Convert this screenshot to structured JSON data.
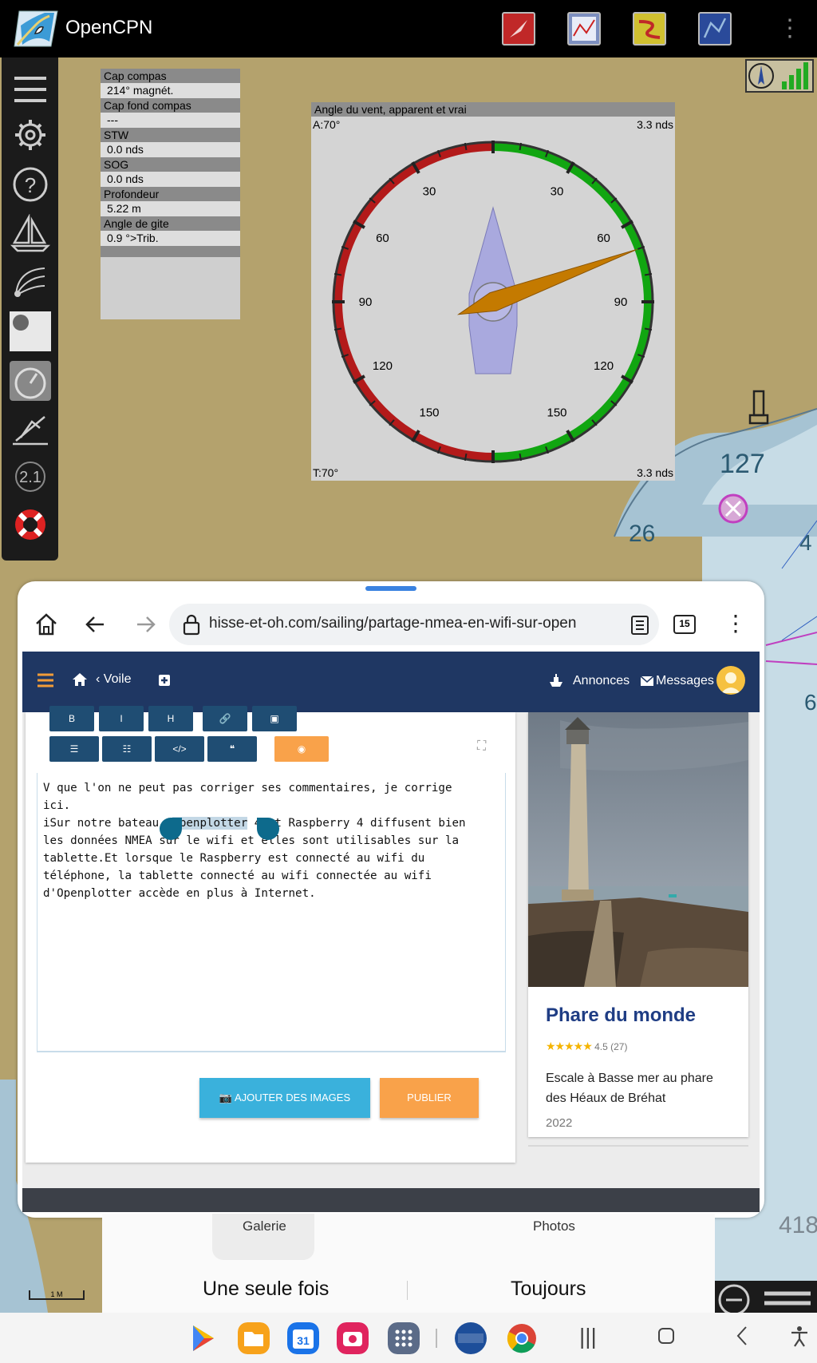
{
  "app": {
    "title": "OpenCPN"
  },
  "instruments": {
    "rows": [
      {
        "label": "Cap compas",
        "value": "214° magnét."
      },
      {
        "label": "Cap fond compas",
        "value": "---"
      },
      {
        "label": "STW",
        "value": "0.0 nds"
      },
      {
        "label": "SOG",
        "value": " 0.0 nds"
      },
      {
        "label": "Profondeur",
        "value": " 5.22 m"
      },
      {
        "label": "Angle de gite",
        "value": "0.9 °>Trib."
      }
    ]
  },
  "wind": {
    "title": "Angle du vent, apparent et vrai",
    "apparent_angle": "A:70°",
    "apparent_speed": "3.3 nds",
    "true_angle": "T:70°",
    "true_speed": "3.3 nds",
    "dial_labels_left": [
      "30",
      "60",
      "90",
      "120",
      "150"
    ],
    "dial_labels_right": [
      "30",
      "60",
      "90",
      "120",
      "150"
    ],
    "apparent_angle_value": 70
  },
  "chart_labels": {
    "depth_127": "127",
    "depth_26": "26",
    "depth_4": "4",
    "depth_6": "6",
    "depth_418": "418",
    "scale": "1 M",
    "zoom_2_1": "2.1"
  },
  "browser": {
    "url": "hisse-et-oh.com/sailing/partage-nmea-en-wifi-sur-open",
    "tabs_count": "15"
  },
  "site": {
    "nav_back_label": "Voile",
    "ads_label": "Annonces",
    "messages_label": "Messages",
    "editor": {
      "format_buttons_row1": [
        "B",
        "I",
        "H",
        "🔗",
        "▣"
      ],
      "format_buttons_row2": [
        "☰",
        "☷",
        "</>",
        "❝"
      ],
      "text_before_selection": "V que l'on ne peut pas corriger ses commentaires, je corrige\nici.\niSur notre bateau, ",
      "selected_text": "Openplotter",
      "text_after_selection": " 4 et Raspberry 4 diffusent bien\nles données NMEA sur le wifi et elles sont utilisables sur la\ntablette.Et lorsque le Raspberry est connecté au wifi du\ntéléphone, la tablette connecté au wifi connectée au wifi\nd'Openplotter accède en plus à Internet.",
      "add_images_label": "AJOUTER DES IMAGES",
      "publish_label": "PUBLIER"
    },
    "spot": {
      "title": "Phare du monde",
      "stars": "★★★★★",
      "rating": "4.5 (27)",
      "rating_value": 4.5,
      "description": "Escale à Basse mer au phare des Héaux de Bréhat",
      "year": "2022"
    }
  },
  "chooser": {
    "option_gallery": "Galerie",
    "option_photos": "Photos",
    "once_label": "Une seule fois",
    "always_label": "Toujours"
  },
  "colors": {
    "chart_land": "#b4a26d",
    "chart_shallow": "#a6c3d3",
    "site_header": "#1f3763",
    "accent_orange": "#f9a24a",
    "accent_blue": "#3ab1dc",
    "spot_title": "#1f3d84"
  }
}
